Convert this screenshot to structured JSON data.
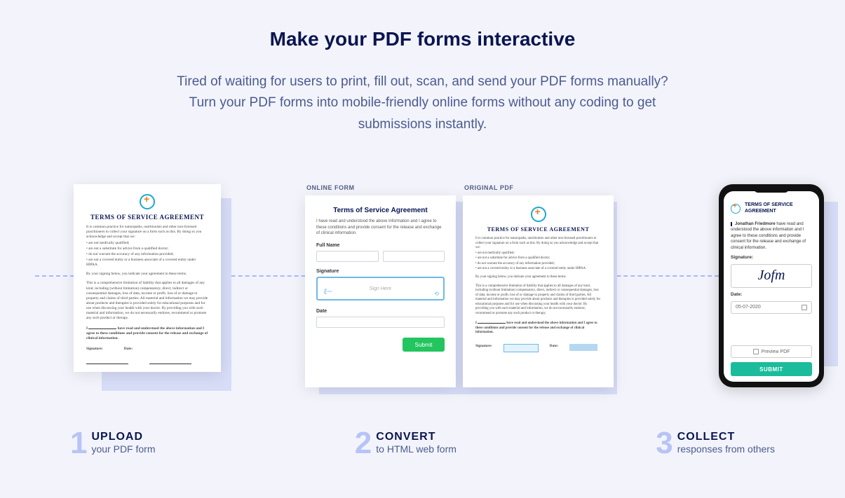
{
  "hero": {
    "title": "Make your PDF forms interactive",
    "subtitle": "Tired of waiting for users to print, fill out, scan, and send your PDF forms manually? Turn your PDF forms into mobile-friendly online forms without any coding to get submissions instantly."
  },
  "doc": {
    "title": "TERMS OF SERVICE AGREEMENT",
    "p1": "It is common practice for naturopaths, nutritionists and other non-licensed practitioners to collect your signature on a form such as this. By doing so you acknowledge and accept that we:",
    "b1": "• are not medically qualified;",
    "b2": "• are not a substitute for advice from a qualified doctor;",
    "b3": "• do not warrant the accuracy of any information provided;",
    "b4": "• are not a covered entity or a business associate of a covered entity under HIPAA.",
    "p2": "By your signing below, you indicate your agreement to these terms.",
    "p3": "This is a comprehensive limitation of liability that applies to all damages of any kind, including (without limitation) compensatory, direct, indirect or consequential damages, loss of data, income or profit, loss of or damage to property and claims of third parties. All material and information we may provide about products and therapies is provided solely for educational purposes and for use when discussing your health with your doctor. By providing you with such material and information, we do not necessarily endorse, recommend or promote any such product or therapy.",
    "p4a": "I ",
    "p4b": " have read and understood the above information and I agree to these conditions and provide consent for the release and exchange of clinical information.",
    "sig_label": "Signature:",
    "date_label": "Date:"
  },
  "panel": {
    "left_head": "ONLINE FORM",
    "right_head": "ORIGINAL PDF",
    "form_title": "Terms of Service Agreement",
    "form_desc": "I have read and understood the above information and I agree to these conditions and provide consent for the release and exchange of clinical information.",
    "full_name": "Full Name",
    "signature": "Signature",
    "sign_here": "Sign Here",
    "date": "Date",
    "submit": "Submit"
  },
  "phone": {
    "title": "TERMS OF SERVICE AGREEMENT",
    "name": "Jonathan Friedmore",
    "text_after": " have read and understood the above information and I agree to these conditions and provide consent for the release and exchange of clinical information.",
    "sig_label": "Signature:",
    "sig_value": "Jofm",
    "date_label": "Date:",
    "date_value": "05-07-2020",
    "preview": "Preview PDF",
    "submit": "SUBMIT"
  },
  "steps": [
    {
      "num": "1",
      "h": "UPLOAD",
      "d": "your PDF form"
    },
    {
      "num": "2",
      "h": "CONVERT",
      "d": "to HTML web form"
    },
    {
      "num": "3",
      "h": "COLLECT",
      "d": "responses from others"
    }
  ]
}
